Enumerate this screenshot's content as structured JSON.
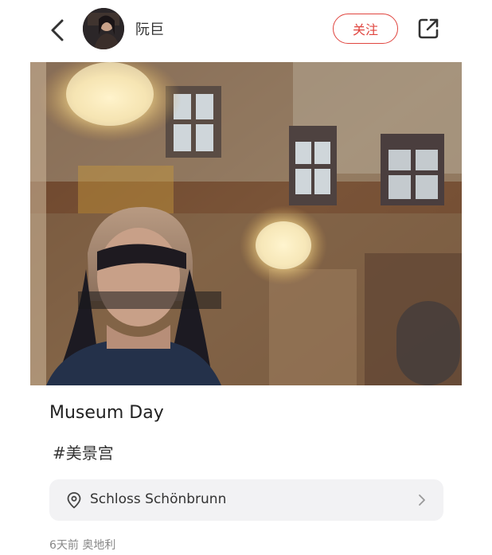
{
  "header": {
    "username": "阮巨",
    "follow_label": "关注"
  },
  "post": {
    "title": "Museum Day",
    "hashtag": "#美景宫",
    "location": "Schloss Schönbrunn",
    "meta": "6天前 奥地利"
  },
  "icons": {
    "back": "chevron-left-icon",
    "share": "share-icon",
    "location": "map-pin-icon",
    "chevron": "chevron-right-icon"
  },
  "colors": {
    "accent": "#e0453f",
    "location_bg": "#f2f2f4"
  }
}
